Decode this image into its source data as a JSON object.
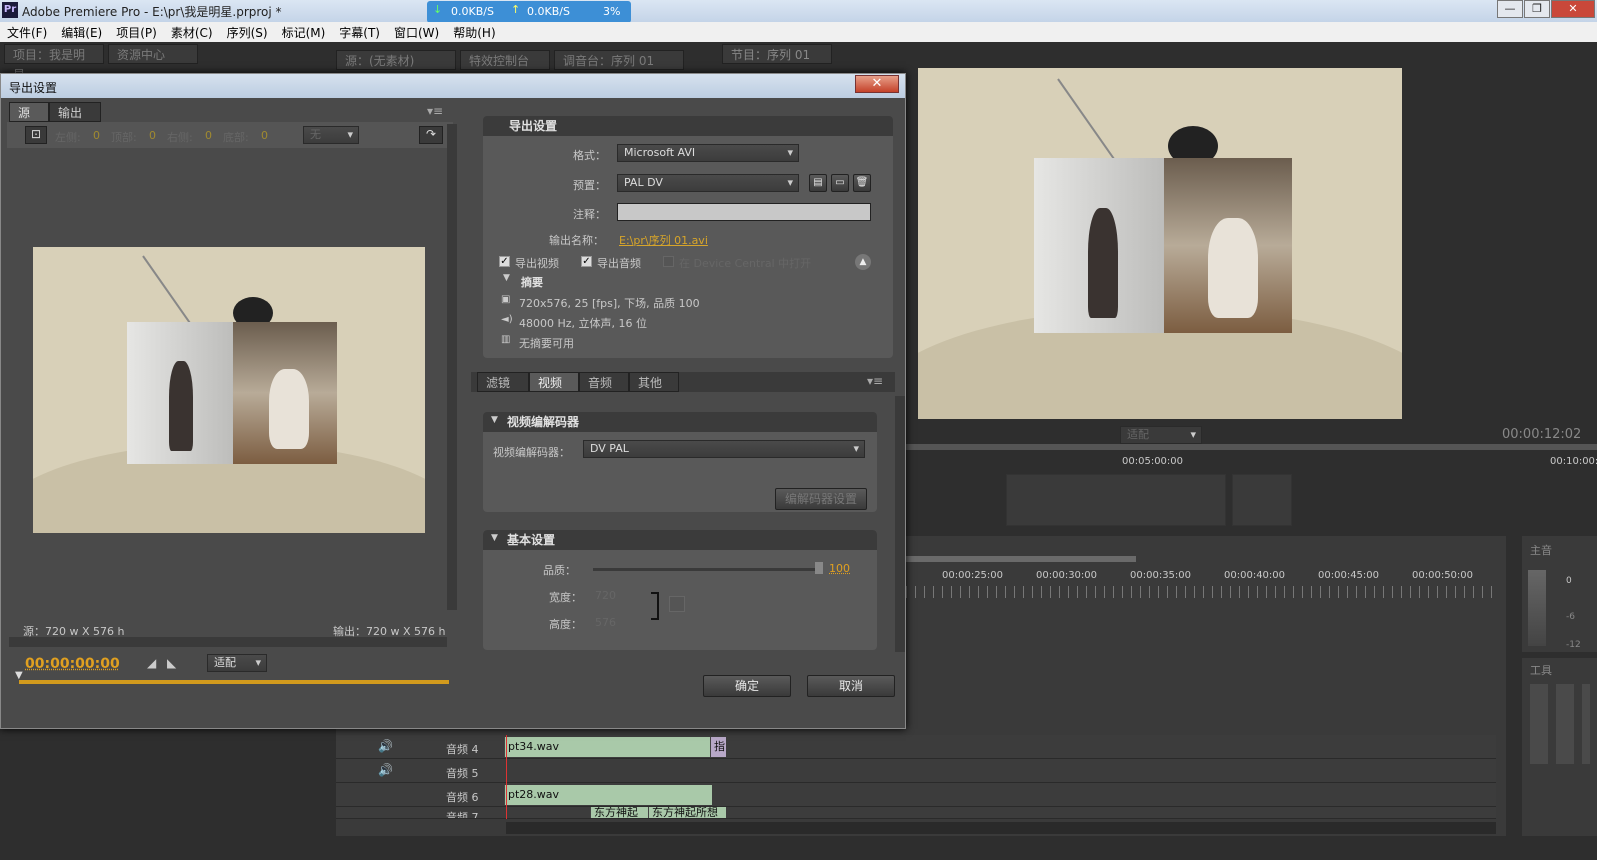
{
  "window": {
    "app_icon": "Pr",
    "title": "Adobe Premiere Pro - E:\\pr\\我是明星.prproj *"
  },
  "network": {
    "down": "0.0KB/S",
    "up": "0.0KB/S",
    "percent": "3%"
  },
  "menu": [
    "文件(F)",
    "编辑(E)",
    "项目(P)",
    "素材(C)",
    "序列(S)",
    "标记(M)",
    "字幕(T)",
    "窗口(W)",
    "帮助(H)"
  ],
  "panels": {
    "project_tab": "项目：我是明星",
    "media_browser_tab": "资源中心",
    "source_tab": "源：(无素材)",
    "effect_controls_tab": "特效控制台",
    "mixer_tab": "调音台：序列 01",
    "program_tab": "节目：序列 01"
  },
  "program": {
    "fit": "适配",
    "timecode": "00:00:12:02",
    "ruler_marks": [
      "00:05:00:00",
      "00:10:00:00"
    ]
  },
  "timeline": {
    "ruler_marks": [
      "00:00:25:00",
      "00:00:30:00",
      "00:00:35:00",
      "00:00:40:00",
      "00:00:45:00",
      "00:00:50:00"
    ],
    "tracks": [
      {
        "name": "音频 4",
        "clip": "pt34.wav",
        "extra": "指"
      },
      {
        "name": "音频 5",
        "clip": "",
        "extra": ""
      },
      {
        "name": "音频 6",
        "clip": "pt28.wav",
        "extra": ""
      },
      {
        "name": "音频 7",
        "clip": "东方神起",
        "extra": "东方神起所想"
      }
    ]
  },
  "master": {
    "label": "主音",
    "db0": "0",
    "db6": "-6",
    "db12": "-12"
  },
  "tools": {
    "label": "工具"
  },
  "dialog": {
    "title": "导出设置",
    "close": "✕",
    "tabs": [
      "源",
      "输出"
    ],
    "crop": {
      "left_label": "左侧:",
      "left": "0",
      "top_label": "顶部:",
      "top": "0",
      "right_label": "右侧:",
      "right": "0",
      "bottom_label": "底部:",
      "bottom": "0",
      "ratio": "无"
    },
    "source_size": "源：720 w X 576 h",
    "output_size": "输出：720 w X 576 h",
    "timecode": "00:00:00:00",
    "fit": "适配",
    "export": {
      "header": "导出设置",
      "format_label": "格式：",
      "format": "Microsoft AVI",
      "preset_label": "预置：",
      "preset": "PAL DV",
      "comment_label": "注释：",
      "comment": "",
      "output_name_label": "输出名称：",
      "output_name": "E:\\pr\\序列 01.avi",
      "export_video": "导出视频",
      "export_audio": "导出音频",
      "device_central": "在 Device Central 中打开",
      "summary_header": "摘要",
      "summary_video": "720x576, 25 [fps], 下场, 品质 100",
      "summary_audio": "48000 Hz, 立体声, 16 位",
      "summary_none": "无摘要可用"
    },
    "settings_tabs": [
      "滤镜",
      "视频",
      "音频",
      "其他"
    ],
    "codec": {
      "header": "视频编解码器",
      "label": "视频编解码器：",
      "value": "DV PAL",
      "settings_btn": "编解码器设置"
    },
    "basic": {
      "header": "基本设置",
      "quality_label": "品质：",
      "quality": "100",
      "width_label": "宽度：",
      "width": "720",
      "height_label": "高度：",
      "height": "576"
    },
    "ok": "确定",
    "cancel": "取消"
  }
}
